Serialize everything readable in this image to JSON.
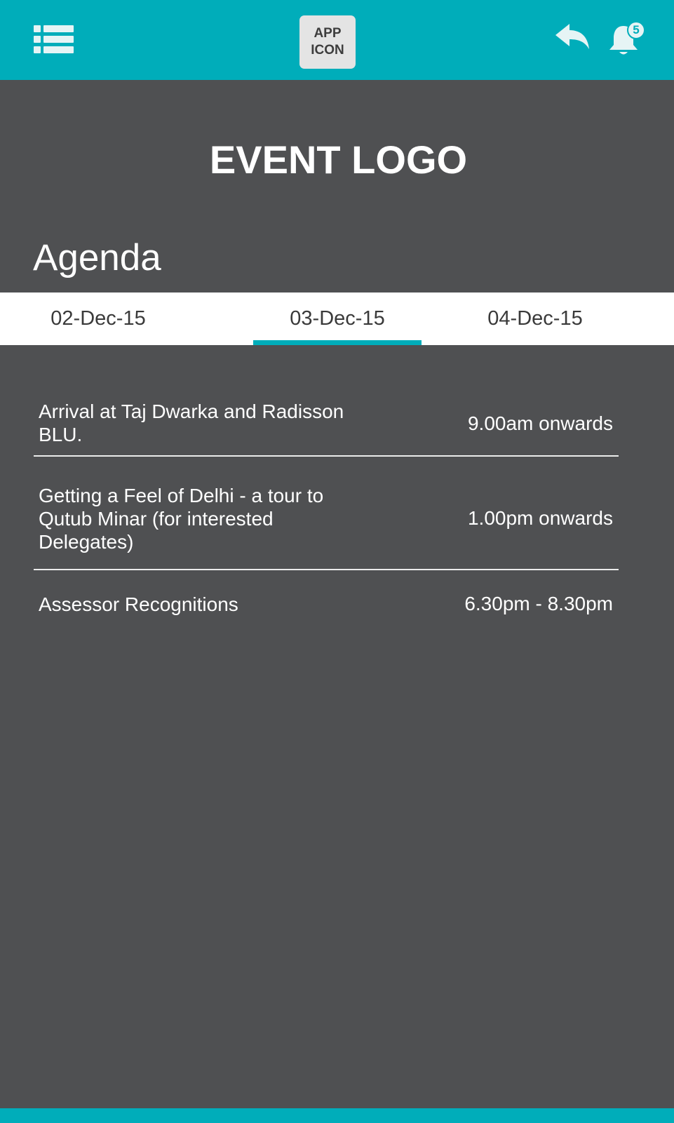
{
  "header": {
    "menu_icon": "list-menu-icon",
    "app_icon_line1": "APP",
    "app_icon_line2": "ICON",
    "back_icon": "reply-arrow-icon",
    "notification_icon": "bell-icon",
    "notification_count": "5"
  },
  "event": {
    "logo_text": "EVENT LOGO"
  },
  "agenda": {
    "title": "Agenda",
    "tabs": [
      {
        "label": "02-Dec-15"
      },
      {
        "label": "03-Dec-15"
      },
      {
        "label": "04-Dec-15"
      }
    ],
    "selected_tab": "03-Dec-15",
    "items": [
      {
        "title": "Arrival at Taj Dwarka and Radisson BLU.",
        "time": "9.00am onwards"
      },
      {
        "title": "Getting a Feel of Delhi - a tour to Qutub Minar (for interested Delegates)",
        "time": "1.00pm onwards"
      },
      {
        "title": "Assessor Recognitions",
        "time": "6.30pm - 8.30pm"
      }
    ]
  },
  "colors": {
    "accent": "#00adba",
    "background": "#4f5052",
    "tab_background": "#ffffff",
    "text": "#ffffff"
  }
}
